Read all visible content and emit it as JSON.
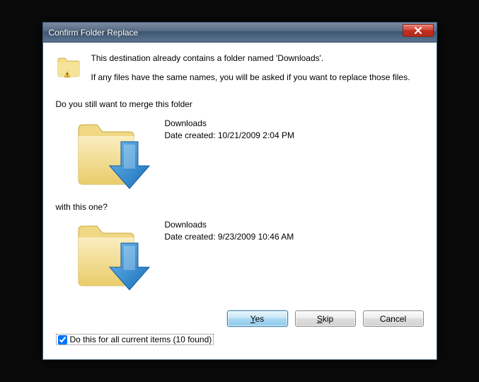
{
  "titlebar": {
    "title": "Confirm Folder Replace"
  },
  "message": {
    "line1": "This destination already contains a folder named 'Downloads'.",
    "line2": "If any files have the same names, you will be asked if you want to replace those files.",
    "question": "Do you still want to merge this folder",
    "with_line": "with this one?"
  },
  "source_folder": {
    "name": "Downloads",
    "created_label": "Date created: 10/21/2009 2:04 PM"
  },
  "dest_folder": {
    "name": "Downloads",
    "created_label": "Date created: 9/23/2009 10:46 AM"
  },
  "buttons": {
    "yes_u": "Y",
    "yes_rest": "es",
    "skip_u": "S",
    "skip_rest": "kip",
    "cancel": "Cancel"
  },
  "footer": {
    "checkbox_label": "Do this for all current items (10 found)",
    "checked": true
  }
}
